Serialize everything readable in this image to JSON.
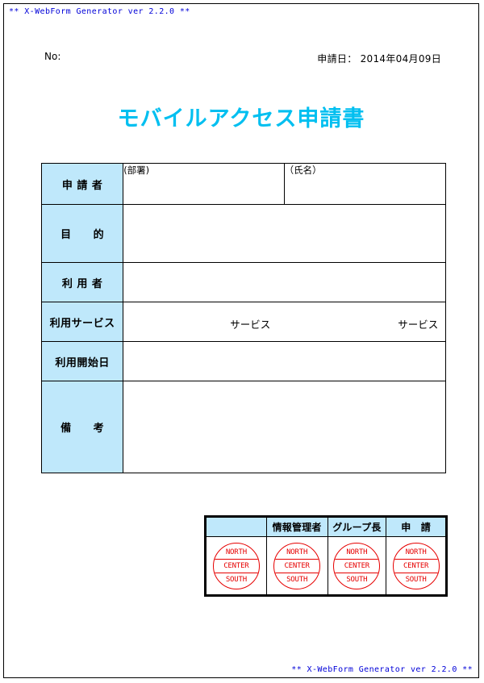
{
  "generator": {
    "banner_top": "** X-WebForm Generator ver 2.2.0 **",
    "banner_bottom": "** X-WebForm Generator ver 2.2.0 **"
  },
  "meta": {
    "no_label": "No:",
    "apply_date": "申請日： 2014年04月09日"
  },
  "title": "モバイルアクセス申請書",
  "form": {
    "rows": [
      {
        "label": "申 請 者",
        "value_left": "(部署)",
        "value_right": "（氏名）"
      },
      {
        "label": "目　　的",
        "value": ""
      },
      {
        "label": "利 用 者",
        "value": ""
      },
      {
        "label": "利用サービス",
        "service_a": "サービス",
        "service_b": "サービス"
      },
      {
        "label": "利用開始日",
        "value": ""
      },
      {
        "label": "備　　考",
        "value": ""
      }
    ]
  },
  "approval": {
    "headers": [
      "",
      "情報管理者",
      "グループ長",
      "申　請"
    ],
    "stamps": [
      {
        "top": "NORTH",
        "mid": "CENTER",
        "bot": "SOUTH"
      },
      {
        "top": "NORTH",
        "mid": "CENTER",
        "bot": "SOUTH"
      },
      {
        "top": "NORTH",
        "mid": "CENTER",
        "bot": "SOUTH"
      },
      {
        "top": "NORTH",
        "mid": "CENTER",
        "bot": "SOUTH"
      }
    ]
  },
  "colors": {
    "banner_blue": "#0000d8",
    "title_cyan": "#00bff0",
    "label_cell_bg": "#bfe8fb",
    "stamp_red": "#e60000",
    "border_black": "#000000"
  }
}
